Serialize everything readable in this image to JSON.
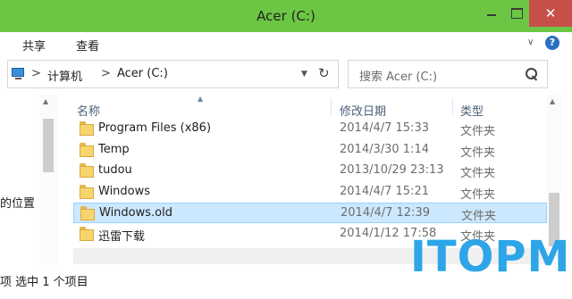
{
  "window": {
    "title": "Acer (C:)",
    "close_glyph": "✕"
  },
  "ribbon": {
    "tabs": [
      {
        "label": "共享"
      },
      {
        "label": "查看"
      }
    ],
    "chevron_glyph": "∨",
    "help_glyph": "?"
  },
  "address": {
    "separator": ">",
    "crumbs": [
      "计算机",
      "Acer (C:)"
    ],
    "dropdown_glyph": "▼",
    "refresh_glyph": "↻"
  },
  "search": {
    "placeholder": "搜索 Acer (C:)"
  },
  "navpane": {
    "visible_text": "的位置"
  },
  "columns": {
    "name": "名称",
    "date": "修改日期",
    "type": "类型"
  },
  "files": [
    {
      "name": "Program Files (x86)",
      "date": "2014/4/7 15:33",
      "type": "文件夹",
      "selected": false
    },
    {
      "name": "Temp",
      "date": "2014/3/30 1:14",
      "type": "文件夹",
      "selected": false
    },
    {
      "name": "tudou",
      "date": "2013/10/29 23:13",
      "type": "文件夹",
      "selected": false
    },
    {
      "name": "Windows",
      "date": "2014/4/7 15:21",
      "type": "文件夹",
      "selected": false
    },
    {
      "name": "Windows.old",
      "date": "2014/4/7 12:39",
      "type": "文件夹",
      "selected": true
    },
    {
      "name": "迅雷下载",
      "date": "2014/1/12 17:58",
      "type": "文件夹",
      "selected": false
    }
  ],
  "status": {
    "text": "项 选中 1 个项目"
  },
  "watermark": {
    "text": "ITOPM"
  },
  "colors": {
    "titlebar": "#6cc644",
    "close_button": "#c7504a",
    "selection": "#cce8ff",
    "watermark": "#2da5e8"
  },
  "icons": {
    "folder": "folder-icon",
    "search": "search-icon",
    "computer": "computer-icon",
    "refresh": "refresh-icon",
    "help": "help-icon"
  }
}
